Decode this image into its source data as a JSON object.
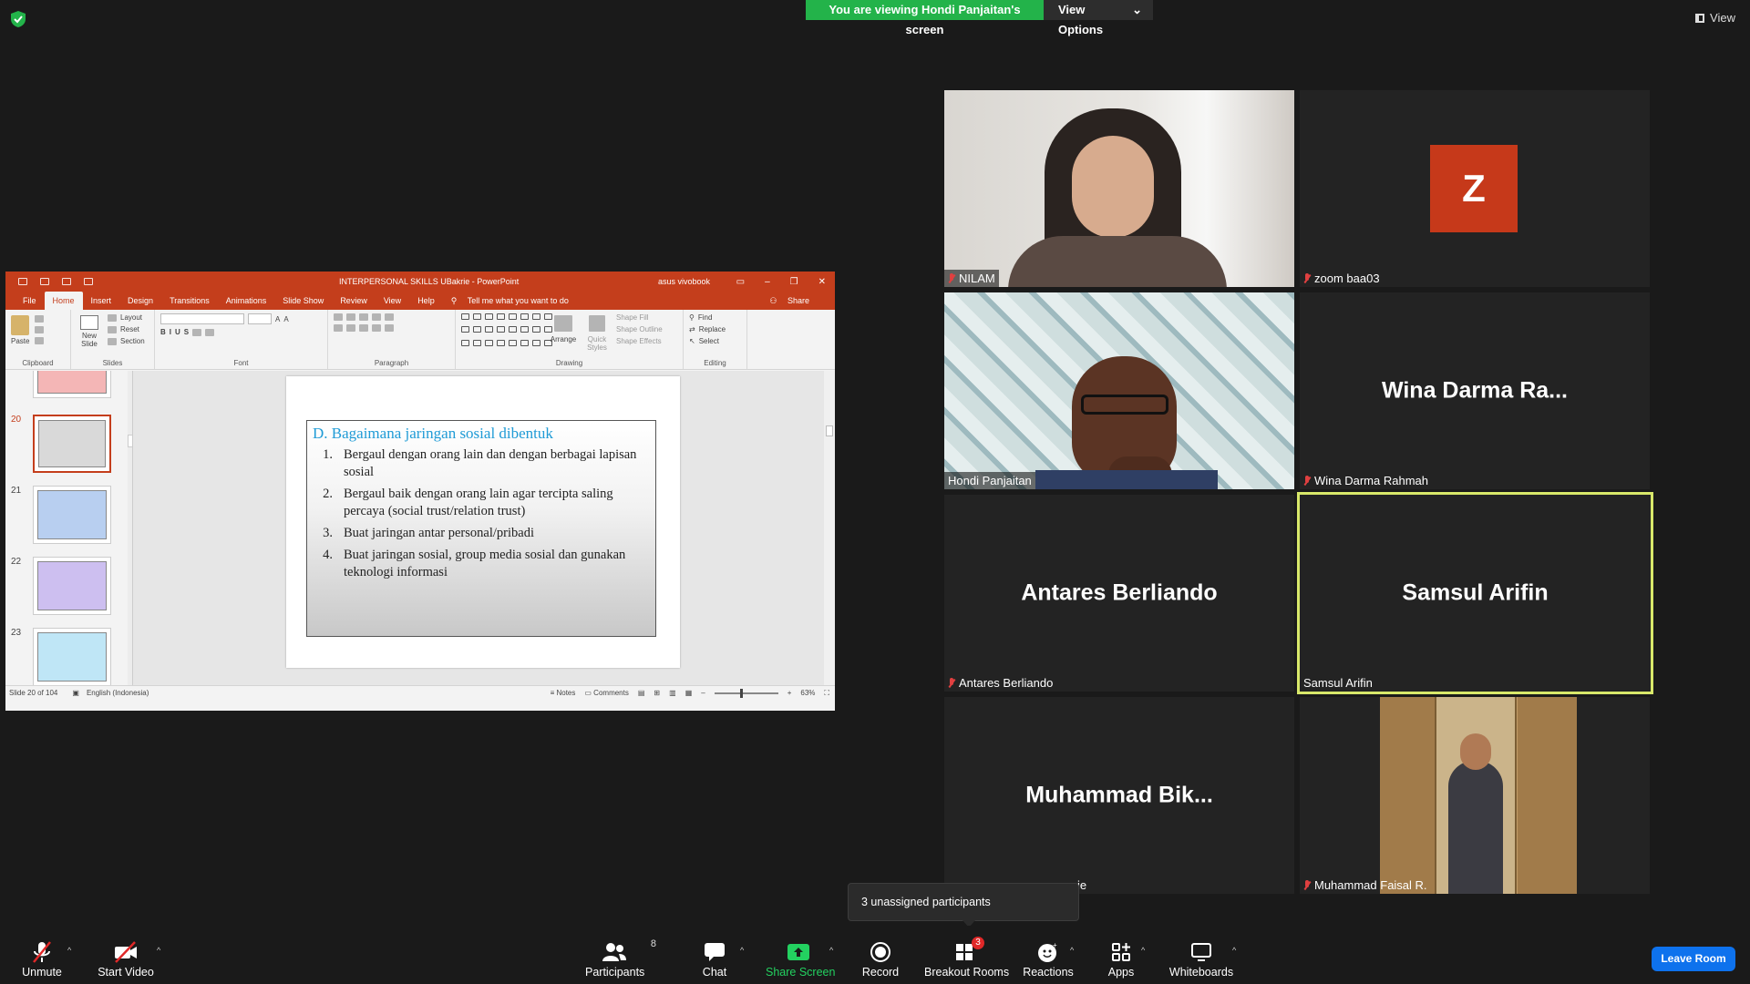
{
  "banner": {
    "viewing_text": "You are viewing Hondi Panjaitan's screen",
    "view_options_label": "View Options",
    "top_view_label": "View"
  },
  "powerpoint": {
    "title": "INTERPERSONAL SKILLS UBakrie  -  PowerPoint",
    "user": "asus vivobook",
    "tabs": [
      "File",
      "Home",
      "Insert",
      "Design",
      "Transitions",
      "Animations",
      "Slide Show",
      "Review",
      "View",
      "Help"
    ],
    "active_tab": "Home",
    "tell_me": "Tell me what you want to do",
    "share_label": "Share",
    "ribbon": {
      "clipboard": {
        "paste": "Paste",
        "group": "Clipboard"
      },
      "slides": {
        "new_slide": "New Slide",
        "layout": "Layout",
        "reset": "Reset",
        "section": "Section",
        "group": "Slides"
      },
      "font_group": "Font",
      "paragraph_group": "Paragraph",
      "drawing": {
        "arrange": "Arrange",
        "quick_styles": "Quick Styles",
        "shape_fill": "Shape Fill",
        "shape_outline": "Shape Outline",
        "shape_effects": "Shape Effects",
        "group": "Drawing"
      },
      "editing": {
        "find": "Find",
        "replace": "Replace",
        "select": "Select",
        "group": "Editing"
      }
    },
    "thumbnails": [
      {
        "num": "",
        "color": "#f4b6b6"
      },
      {
        "num": "20",
        "color": "#d9d9d9",
        "selected": true
      },
      {
        "num": "21",
        "color": "#b8cff0"
      },
      {
        "num": "22",
        "color": "#cdbff0"
      },
      {
        "num": "23",
        "color": "#bfe6f6"
      }
    ],
    "slide": {
      "title": "D. Bagaimana jaringan sosial dibentuk",
      "items": [
        {
          "n": "1.",
          "text": "Bergaul  dengan orang lain dan dengan berbagai lapisan  sosial"
        },
        {
          "n": "2.",
          "text": "Bergaul baik dengan orang lain agar tercipta saling percaya (social trust/relation trust)"
        },
        {
          "n": "3.",
          "text": "Buat jaringan antar personal/pribadi"
        },
        {
          "n": "4.",
          "text": "Buat jaringan sosial, group media sosial dan gunakan teknologi informasi"
        }
      ]
    },
    "status": {
      "slide_info": "Slide 20 of 104",
      "language": "English (Indonesia)",
      "notes": "Notes",
      "comments": "Comments",
      "zoom": "63%"
    }
  },
  "participants": [
    {
      "label": "NILAM",
      "muted": true,
      "type": "video1"
    },
    {
      "label": "zoom baa03",
      "muted": true,
      "type": "avatar",
      "avatar_letter": "Z"
    },
    {
      "label": "Hondi Panjaitan",
      "muted": false,
      "type": "video2"
    },
    {
      "label": "Wina Darma Rahmah",
      "muted": true,
      "type": "name",
      "center_name": "Wina Darma Ra..."
    },
    {
      "label": "Antares Berliando",
      "muted": true,
      "type": "name",
      "center_name": "Antares Berliando"
    },
    {
      "label": "Samsul Arifin",
      "muted": false,
      "type": "name",
      "center_name": "Samsul Arifin",
      "active_speaker": true
    },
    {
      "label": "ie",
      "muted": false,
      "type": "name",
      "center_name": "Muhammad  Bik..."
    },
    {
      "label": "Muhammad Faisal R.",
      "muted": true,
      "type": "video3"
    }
  ],
  "tooltip": {
    "text": "3 unassigned participants"
  },
  "toolbar": {
    "unmute": "Unmute",
    "start_video": "Start Video",
    "participants": "Participants",
    "participants_count": "8",
    "chat": "Chat",
    "share_screen": "Share Screen",
    "record": "Record",
    "breakout_rooms": "Breakout Rooms",
    "breakout_badge": "3",
    "reactions": "Reactions",
    "apps": "Apps",
    "whiteboards": "Whiteboards",
    "leave_room": "Leave Room"
  },
  "colors": {
    "green": "#23b34a",
    "ppt_accent": "#c43e1c",
    "zoom_blue": "#0e72ed",
    "active_speaker": "#d8e86a",
    "muted_red": "#e04040"
  }
}
